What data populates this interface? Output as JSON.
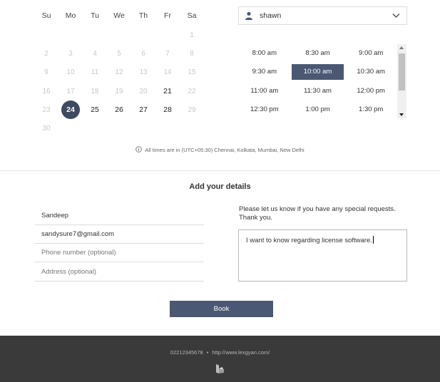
{
  "calendar": {
    "weekdays": [
      "Su",
      "Mo",
      "Tu",
      "We",
      "Th",
      "Fr",
      "Sa"
    ],
    "weeks": [
      [
        "",
        "",
        "",
        "",
        "",
        "",
        "1"
      ],
      [
        "2",
        "3",
        "4",
        "5",
        "6",
        "7",
        "8"
      ],
      [
        "9",
        "10",
        "11",
        "12",
        "13",
        "14",
        "15"
      ],
      [
        "16",
        "17",
        "18",
        "19",
        "20",
        "21",
        "22"
      ],
      [
        "23",
        "24",
        "25",
        "26",
        "27",
        "28",
        "29"
      ],
      [
        "30",
        "",
        "",
        "",
        "",
        "",
        ""
      ]
    ],
    "available_days": [
      "21",
      "24",
      "25",
      "26",
      "27",
      "28"
    ],
    "selected_day": "24"
  },
  "staff": {
    "selected": "shawn",
    "icon": "person-icon"
  },
  "time_slots": {
    "rows": [
      [
        "8:00 am",
        "8:30 am",
        "9:00 am"
      ],
      [
        "9:30 am",
        "10:00 am",
        "10:30 am"
      ],
      [
        "11:00 am",
        "11:30 am",
        "12:00 pm"
      ],
      [
        "12:30 pm",
        "1:00 pm",
        "1:30 pm"
      ]
    ],
    "selected": "10:00 am"
  },
  "timezone_note": "All times are in (UTC+05:30) Chennai, Kolkata, Mumbai, New Delhi",
  "details": {
    "title": "Add your details",
    "name_value": "Sandeep",
    "email_value": "sandysure7@gmail.com",
    "phone_placeholder": "Phone number (optional)",
    "address_placeholder": "Address (optional)",
    "requests_label": "Please let us know if you have any special requests. Thank you.",
    "requests_value": "I want to know regarding license software."
  },
  "book_label": "Book",
  "footer": {
    "phone": "02212345678",
    "separator": "•",
    "url": "http://www.lexgyan.com/"
  },
  "colors": {
    "accent": "#4a5873",
    "selected_day": "#3e4a60",
    "footer_bg": "#3a3a3a"
  }
}
